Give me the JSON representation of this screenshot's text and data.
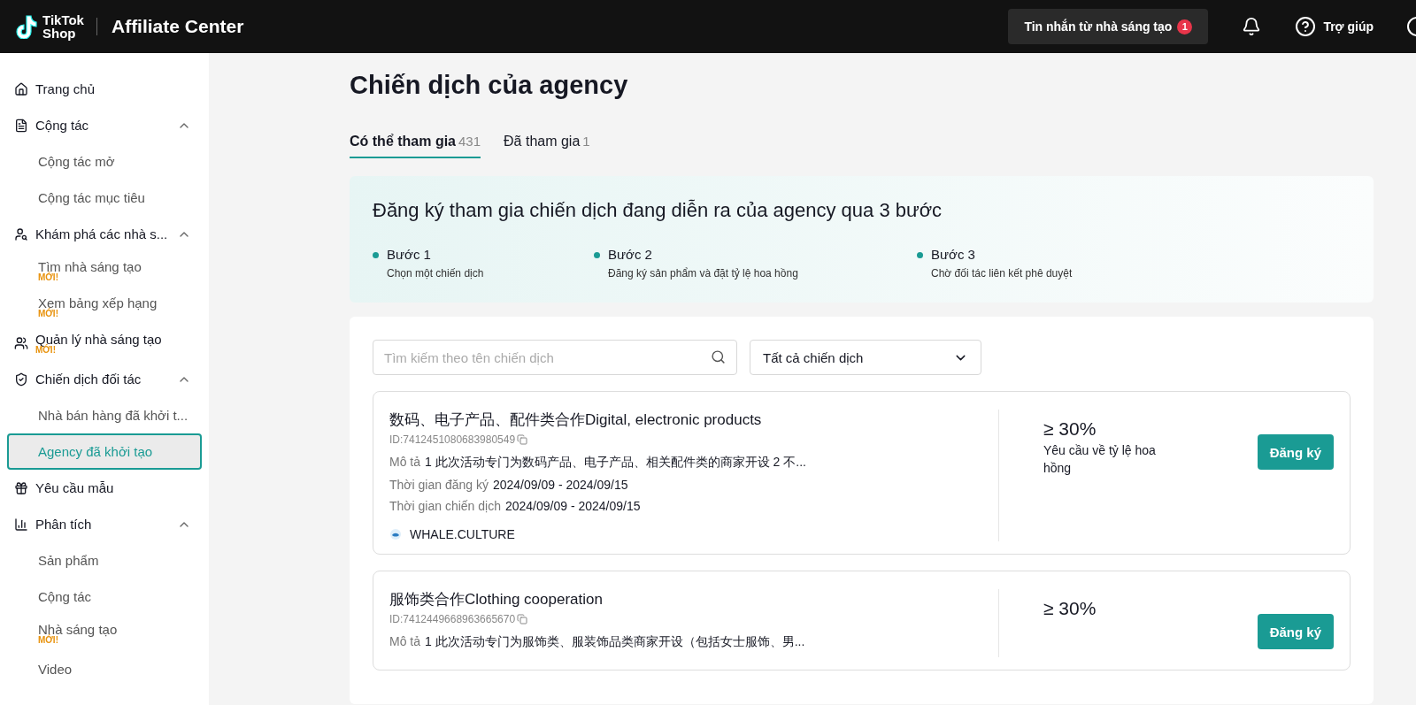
{
  "header": {
    "logo_top": "TikTok",
    "logo_bottom": "Shop",
    "title": "Affiliate Center",
    "messages": {
      "label": "Tin nhắn từ nhà sáng tạo",
      "badge": "1"
    },
    "help": "Trợ giúp"
  },
  "sidebar": {
    "items": [
      {
        "kind": "link",
        "label": "Trang chủ",
        "selected": false
      },
      {
        "kind": "group",
        "label": "Cộng tác",
        "expanded": true,
        "children": [
          {
            "label": "Cộng tác mở",
            "selected": false
          },
          {
            "label": "Cộng tác mục tiêu",
            "selected": false
          }
        ]
      },
      {
        "kind": "group",
        "label": "Khám phá các nhà s...",
        "expanded": true,
        "children": [
          {
            "label": "Tìm nhà sáng tạo",
            "badge": "MỚI!",
            "selected": false
          },
          {
            "label": "Xem bảng xếp hạng",
            "badge": "MỚI!",
            "selected": false
          }
        ]
      },
      {
        "kind": "link",
        "label": "Quản lý nhà sáng tạo",
        "badge": "MỚI!",
        "selected": false
      },
      {
        "kind": "group",
        "label": "Chiến dịch đối tác",
        "expanded": true,
        "children": [
          {
            "label": "Nhà bán hàng đã khởi t...",
            "selected": false
          },
          {
            "label": "Agency đã khởi tạo",
            "selected": true
          }
        ]
      },
      {
        "kind": "link",
        "label": "Yêu cầu mẫu",
        "selected": false
      },
      {
        "kind": "group",
        "label": "Phân tích",
        "expanded": true,
        "children": [
          {
            "label": "Sản phẩm",
            "selected": false
          },
          {
            "label": "Cộng tác",
            "selected": false
          },
          {
            "label": "Nhà sáng tạo",
            "badge": "MỚI!",
            "selected": false
          },
          {
            "label": "Video",
            "selected": false
          }
        ]
      }
    ]
  },
  "page_title": "Chiến dịch của agency",
  "tabs": [
    {
      "label": "Có thể tham gia",
      "count": "431",
      "selected": true
    },
    {
      "label": "Đã tham gia",
      "count": "1",
      "selected": false
    }
  ],
  "steps_banner": {
    "title": "Đăng ký tham gia chiến dịch đang diễn ra của agency qua 3 bước",
    "steps": [
      {
        "title": "Bước 1",
        "description": "Chọn một chiến dịch"
      },
      {
        "title": "Bước 2",
        "description": "Đăng ký sản phẩm và đặt tỷ lệ hoa hồng"
      },
      {
        "title": "Bước 3",
        "description": "Chờ đối tác liên kết phê duyệt"
      }
    ]
  },
  "search": {
    "placeholder": "Tìm kiếm theo tên chiến dịch"
  },
  "filter": {
    "value": "Tất cả chiến dịch"
  },
  "campaigns": [
    {
      "title": "数码、电子产品、配件类合作Digital, electronic products",
      "id": "ID:7412451080683980549",
      "description_label": "Mô tả",
      "description": "1 此次活动专门为数码产品、电子产品、相关配件类的商家开设 2 不...",
      "registration_label": "Thời gian đăng ký",
      "registration": "2024/09/09 - 2024/09/15",
      "period_label": "Thời gian chiến dịch",
      "period": "2024/09/09 - 2024/09/15",
      "owner": "WHALE.CULTURE",
      "commission": "≥ 30%",
      "commission_label": "Yêu cầu về tỷ lệ hoa hồng",
      "button": "Đăng ký"
    },
    {
      "title": "服饰类合作Clothing cooperation",
      "id": "ID:7412449668963665670",
      "description_label": "Mô tả",
      "description": "1 此次活动专门为服饰类、服装饰品类商家开设（包括女士服饰、男...",
      "commission": "≥ 30%",
      "button": "Đăng ký"
    }
  ]
}
